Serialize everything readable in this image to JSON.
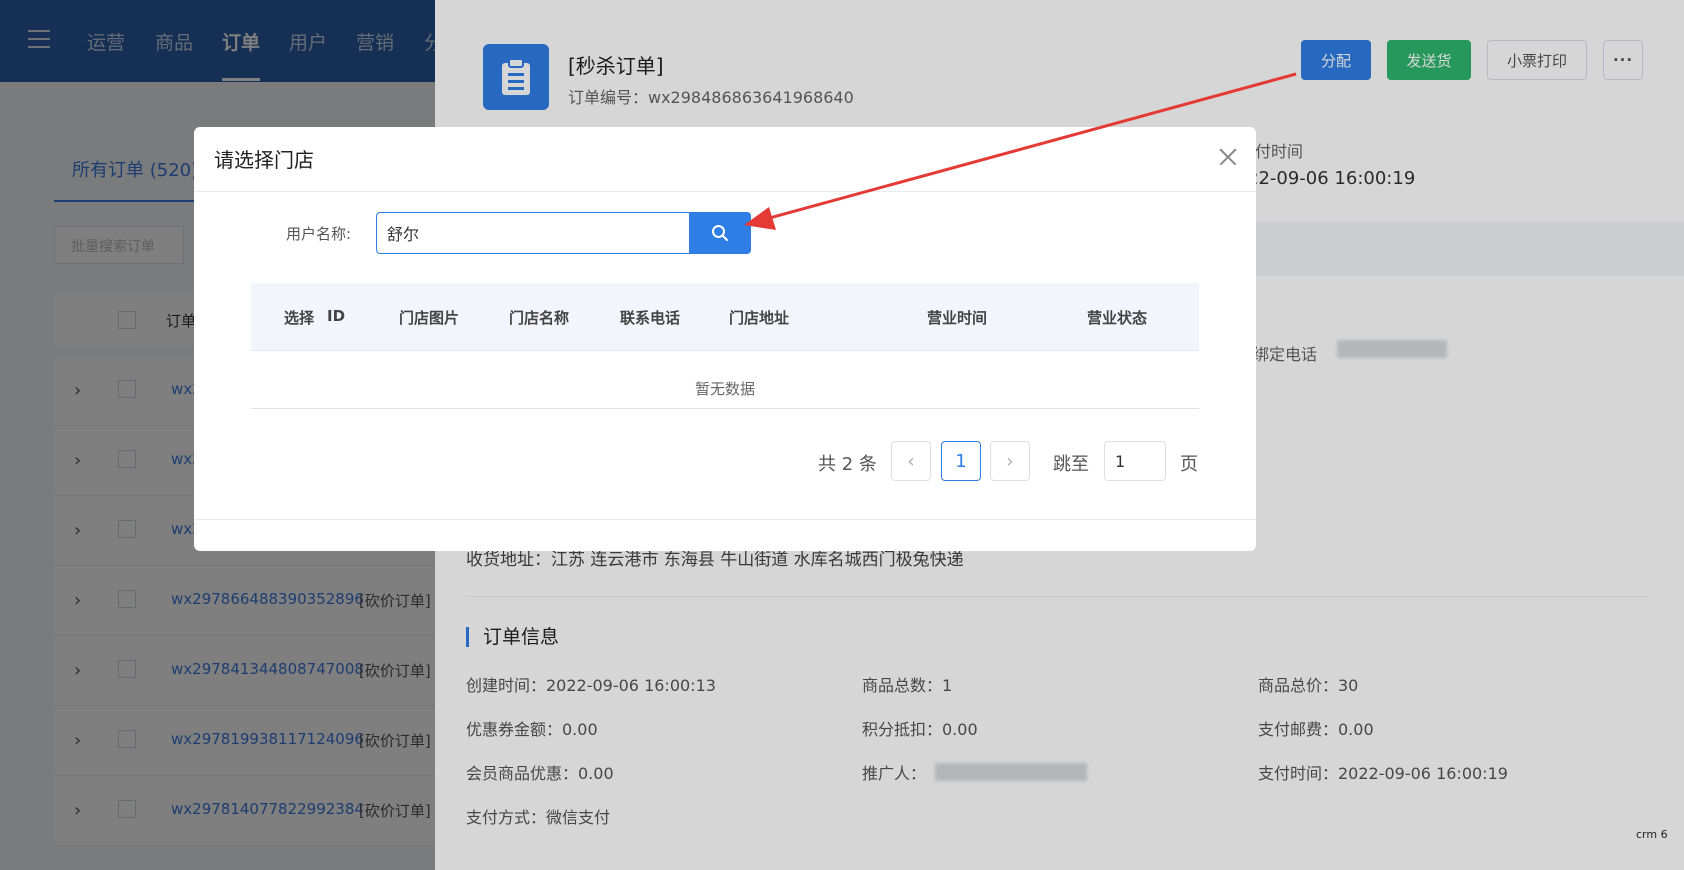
{
  "topnav": {
    "items": [
      "运营",
      "商品",
      "订单",
      "用户",
      "营销",
      "分"
    ],
    "active_index": 2
  },
  "order_list": {
    "tab_all": "所有订单 (520)",
    "batch_search_placeholder": "批量搜索订单",
    "header_label": "订单",
    "rows": [
      {
        "id": "wx2",
        "type": ""
      },
      {
        "id": "wx2",
        "type": ""
      },
      {
        "id": "wx2",
        "type": ""
      },
      {
        "id": "wx297866488390352896",
        "type": "[砍价订单]"
      },
      {
        "id": "wx297841344808747008",
        "type": "[砍价订单]"
      },
      {
        "id": "wx297819938117124096",
        "type": "[砍价订单]"
      },
      {
        "id": "wx297814077822992384",
        "type": "[砍价订单]"
      }
    ]
  },
  "detail": {
    "title": "[秒杀订单]",
    "order_no": "订单编号：wx298486863641968640",
    "buttons": {
      "assign": "分配",
      "ship": "发送货",
      "receipt": "小票打印",
      "more": "···"
    },
    "pay_time_label": "付时间",
    "pay_time_value": "22-09-06 16:00:19",
    "bind_phone_label": "绑定电话",
    "address": "收货地址：江苏 连云港市 东海县 牛山街道 水库名城西门极兔快递",
    "section_title": "订单信息",
    "info": {
      "create_time": "创建时间：2022-09-06 16:00:13",
      "goods_count": "商品总数：1",
      "goods_total": "商品总价：30",
      "coupon": "优惠券金额：0.00",
      "points": "积分抵扣：0.00",
      "postage": "支付邮费：0.00",
      "member_discount": "会员商品优惠：0.00",
      "promoter": "推广人：",
      "pay_time": "支付时间：2022-09-06 16:00:19",
      "pay_method": "支付方式：微信支付"
    }
  },
  "modal": {
    "title": "请选择门店",
    "username_label": "用户名称:",
    "search_value": "舒尔",
    "columns": [
      "选择",
      "ID",
      "门店图片",
      "门店名称",
      "联系电话",
      "门店地址",
      "营业时间",
      "营业状态"
    ],
    "empty_text": "暂无数据",
    "pagination": {
      "total_text": "共 2 条",
      "current_page": "1",
      "jump_label": "跳至",
      "jump_value": "1",
      "page_unit": "页",
      "prev_icon": "‹",
      "next_icon": "›"
    }
  },
  "watermark": "crm 6",
  "colors": {
    "primary": "#2f7ee6",
    "success": "#2fb56e",
    "nav": "#2d5ea8",
    "annotation": "#e53935"
  }
}
